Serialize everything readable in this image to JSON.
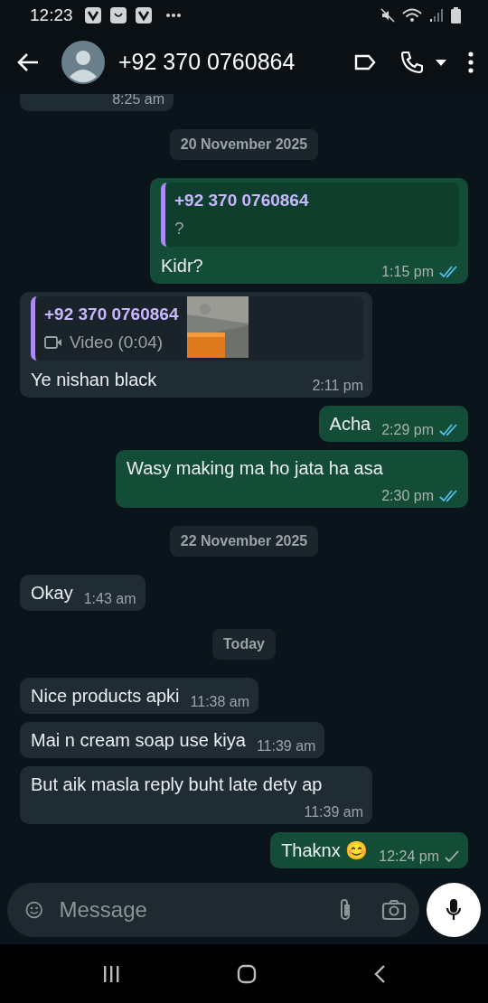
{
  "status_bar": {
    "time": "12:23"
  },
  "header": {
    "title": "+92 370 0760864"
  },
  "messages": [
    {
      "kind": "partial_in",
      "time": "8:25 am"
    },
    {
      "kind": "date",
      "text": "20 November 2025"
    },
    {
      "kind": "out",
      "quote": {
        "kind": "text",
        "author": "+92 370 0760864",
        "text": "?"
      },
      "text": "Kidr?",
      "time": "1:15 pm",
      "read": true
    },
    {
      "kind": "in",
      "quote": {
        "kind": "video",
        "author": "+92 370 0760864",
        "text": "Video (0:04)"
      },
      "text": "Ye nishan black",
      "time": "2:11 pm"
    },
    {
      "kind": "out",
      "text": "Acha",
      "time": "2:29 pm",
      "read": true
    },
    {
      "kind": "out",
      "text": "Wasy making ma ho jata ha asa",
      "time": "2:30 pm",
      "read": true
    },
    {
      "kind": "date",
      "text": "22 November 2025"
    },
    {
      "kind": "in",
      "text": "Okay",
      "time": "1:43 am"
    },
    {
      "kind": "date",
      "text": "Today"
    },
    {
      "kind": "in",
      "text": "Nice products apki",
      "time": "11:38 am"
    },
    {
      "kind": "in",
      "text": "Mai n cream soap use kiya",
      "time": "11:39 am"
    },
    {
      "kind": "in",
      "text": "But aik masla reply buht late dety ap",
      "time": "11:39 am"
    },
    {
      "kind": "out",
      "text": "Thaknx 😊",
      "time": "12:24 pm",
      "read": false
    }
  ],
  "composer": {
    "placeholder": "Message"
  }
}
